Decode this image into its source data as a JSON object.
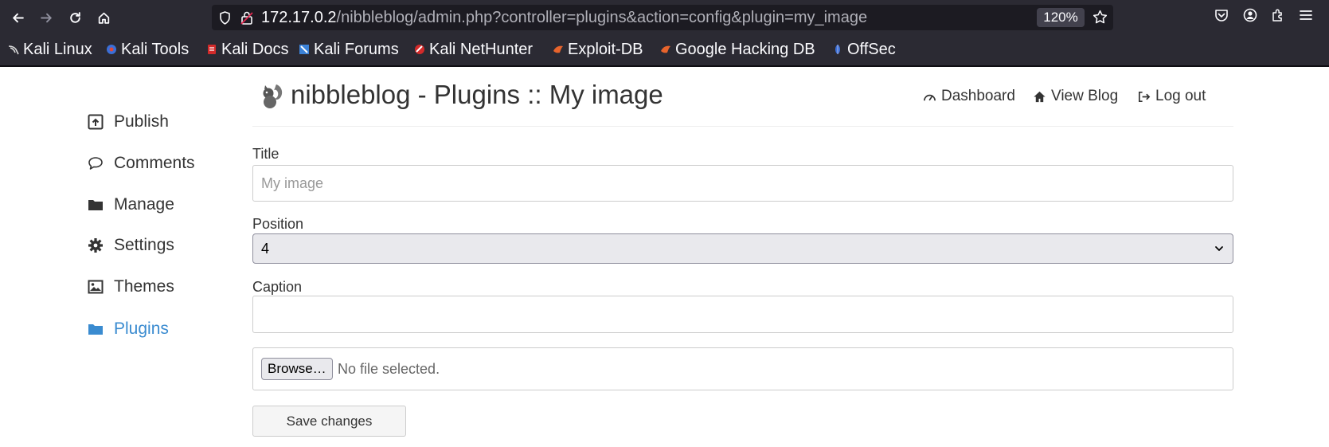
{
  "browser": {
    "url_host": "172.17.0.2",
    "url_path": "/nibbleblog/admin.php?controller=plugins&action=config&plugin=my_image",
    "zoom": "120%",
    "bookmarks": [
      {
        "label": "Kali Linux",
        "icon": "kali-dragon-icon"
      },
      {
        "label": "Kali Tools",
        "icon": "kali-tools-icon"
      },
      {
        "label": "Kali Docs",
        "icon": "kali-docs-icon"
      },
      {
        "label": "Kali Forums",
        "icon": "kali-forums-icon"
      },
      {
        "label": "Kali NetHunter",
        "icon": "nethunter-icon"
      },
      {
        "label": "Exploit-DB",
        "icon": "exploit-db-icon"
      },
      {
        "label": "Google Hacking DB",
        "icon": "ghdb-icon"
      },
      {
        "label": "OffSec",
        "icon": "offsec-icon"
      }
    ]
  },
  "sidebar": {
    "items": [
      {
        "label": "Publish",
        "icon": "publish-icon"
      },
      {
        "label": "Comments",
        "icon": "comment-icon"
      },
      {
        "label": "Manage",
        "icon": "folder-icon"
      },
      {
        "label": "Settings",
        "icon": "gear-icon"
      },
      {
        "label": "Themes",
        "icon": "picture-icon"
      },
      {
        "label": "Plugins",
        "icon": "folder-open-icon",
        "active": true
      }
    ]
  },
  "header": {
    "title": "nibbleblog - Plugins :: My image",
    "links": [
      {
        "label": "Dashboard",
        "icon": "dashboard-icon"
      },
      {
        "label": "View Blog",
        "icon": "home-icon"
      },
      {
        "label": "Log out",
        "icon": "logout-icon"
      }
    ]
  },
  "form": {
    "title_label": "Title",
    "title_placeholder": "My image",
    "title_value": "",
    "position_label": "Position",
    "position_value": "4",
    "caption_label": "Caption",
    "caption_value": "",
    "browse_label": "Browse…",
    "file_status": "No file selected.",
    "save_label": "Save changes"
  },
  "colors": {
    "accent": "#3a8bd0",
    "text": "#333333",
    "chrome_bg": "#2b2a33"
  }
}
